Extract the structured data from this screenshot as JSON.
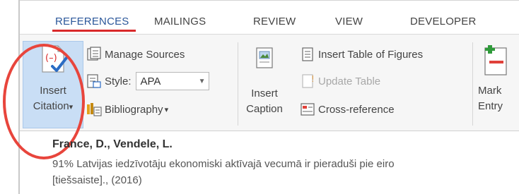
{
  "tabs": {
    "references": "REFERENCES",
    "mailings": "MAILINGS",
    "review": "REVIEW",
    "view": "VIEW",
    "developer": "DEVELOPER"
  },
  "ribbon": {
    "insert_citation": {
      "line1": "Insert",
      "line2": "Citation",
      "arrow": "▾"
    },
    "manage_sources": "Manage Sources",
    "style_label": "Style:",
    "style_value": "APA",
    "bibliography": "Bibliography",
    "bibliography_arrow": "▾",
    "insert_caption": {
      "line1": "Insert",
      "line2": "Caption"
    },
    "insert_table_of_figures": "Insert Table of Figures",
    "update_table": "Update Table",
    "cross_reference": "Cross-reference",
    "mark_entry": {
      "line1": "Mark",
      "line2": "Entry"
    }
  },
  "citation_preview": {
    "author": "France, D., Vendele, L.",
    "title": "91% Latvijas iedzīvotāju ekonomiski aktīvajā vecumā ir pieraduši pie eiro",
    "meta": "[tiešsaiste]., (2016)"
  },
  "colors": {
    "accent": "#2b579a",
    "tab_underline": "#d9292a",
    "annotation_circle": "#e8453c",
    "selected_button": "#c9def5"
  }
}
